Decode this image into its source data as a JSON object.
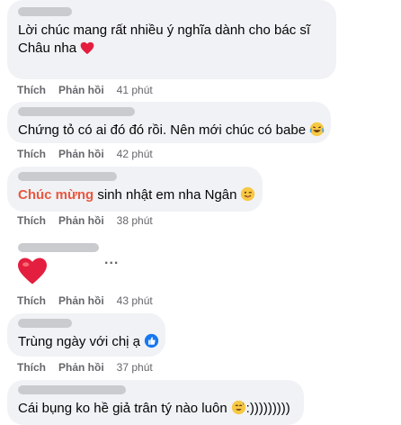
{
  "comments": [
    {
      "text": "Lời chúc mang rất nhiều ý nghĩa dành cho bác sĩ Châu nha",
      "emoji": "red-heart",
      "actions": {
        "like": "Thích",
        "reply": "Phản hồi",
        "time": "41 phút"
      }
    },
    {
      "text": "Chứng tỏ có ai đó đó rồi. Nên mới chúc có babe",
      "emoji": "laughing-tears",
      "actions": {
        "like": "Thích",
        "reply": "Phản hồi",
        "time": "42 phút"
      }
    },
    {
      "highlight": "Chúc mừng",
      "text": " sinh nhật em nha Ngân",
      "emoji": "winking-tongue",
      "actions": {
        "like": "Thích",
        "reply": "Phản hồi",
        "time": "38 phút"
      }
    },
    {
      "emoji": "big-red-heart",
      "more": "...",
      "actions": {
        "like": "Thích",
        "reply": "Phản hồi",
        "time": "43 phút"
      }
    },
    {
      "text": "Trùng ngày với chị ạ",
      "emoji": "like-thumb",
      "actions": {
        "like": "Thích",
        "reply": "Phản hồi",
        "time": "37 phút"
      }
    },
    {
      "text": "Cái bụng ko hề giả trân tý nào luôn",
      "suffix": ":)))))))))",
      "emoji": "sweat-smile"
    }
  ],
  "colors": {
    "bubble": "#f0f2f5",
    "meta": "#65676b",
    "highlight": "#e9573f",
    "heart": "#e41e3f",
    "like": "#1877f2"
  }
}
